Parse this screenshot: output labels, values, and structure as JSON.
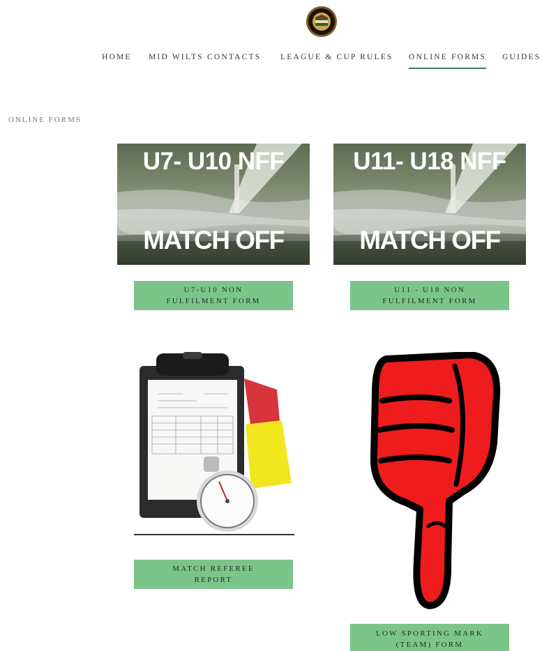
{
  "nav": {
    "items": [
      {
        "label": "HOME",
        "active": false
      },
      {
        "label": "MID WILTS CONTACTS",
        "active": false
      },
      {
        "label": "LEAGUE & CUP RULES",
        "active": false
      },
      {
        "label": "ONLINE FORMS",
        "active": true
      },
      {
        "label": "GUIDES",
        "active": false
      }
    ]
  },
  "page": {
    "title": "ONLINE FORMS"
  },
  "forms": [
    {
      "image_title": "U7- U10 NFF",
      "image_subtitle": "MATCH OFF",
      "button_line1": "U7-U10 NON",
      "button_line2": "FULFILMENT FORM"
    },
    {
      "image_title": "U11- U18 NFF",
      "image_subtitle": "MATCH OFF",
      "button_line1": "U11 - U18 NON",
      "button_line2": "FULFILMENT FORM"
    },
    {
      "image_icon": "clipboard-stopwatch-cards-icon",
      "button_line1": "MATCH REFEREE",
      "button_line2": "REPORT"
    },
    {
      "image_icon": "thumbs-down-icon",
      "button_line1": "LOW SPORTING MARK",
      "button_line2": "(TEAM) FORM"
    }
  ],
  "colors": {
    "button_bg": "#7cc58a",
    "active_underline": "#3f7b5a",
    "thumb_red": "#ee1c1c"
  }
}
